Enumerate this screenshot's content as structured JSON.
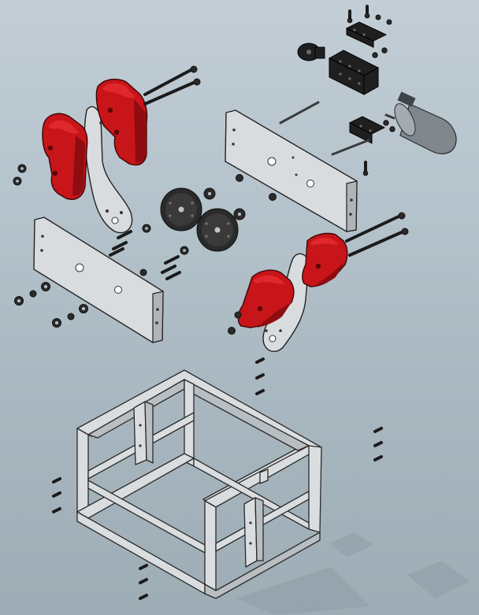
{
  "scene": {
    "kind": "exploded assembly render",
    "colors": {
      "background_top": "#c3ced6",
      "background_bottom": "#9eacb5",
      "plate": "#d9dcdf",
      "red_part": "#c8151a",
      "hardware": "#2b2b2b",
      "frame": "#dadddf"
    },
    "parts": [
      {
        "name": "left-side-plate",
        "icon": "plate-icon"
      },
      {
        "name": "top-plate",
        "icon": "plate-icon"
      },
      {
        "name": "left-curved-arm",
        "icon": "arm-icon"
      },
      {
        "name": "right-curved-arm",
        "icon": "arm-icon"
      },
      {
        "name": "red-jaw-left-front",
        "icon": "jaw-icon"
      },
      {
        "name": "red-jaw-left-rear",
        "icon": "jaw-icon"
      },
      {
        "name": "red-jaw-right-front",
        "icon": "jaw-icon"
      },
      {
        "name": "red-jaw-right-rear",
        "icon": "jaw-icon"
      },
      {
        "name": "gear-pair",
        "icon": "gear-icon"
      },
      {
        "name": "gearmotor",
        "icon": "motor-icon"
      },
      {
        "name": "channel-brackets",
        "icon": "bracket-icon"
      },
      {
        "name": "base-frame",
        "icon": "frame-icon"
      },
      {
        "name": "fasteners",
        "icon": "bolt-icon"
      }
    ]
  }
}
